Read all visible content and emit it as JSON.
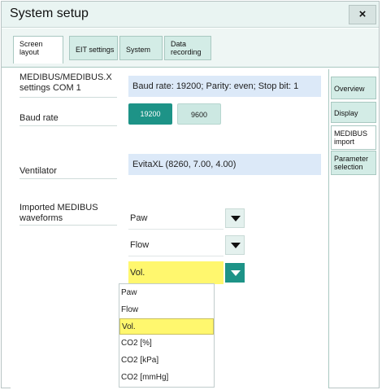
{
  "window": {
    "title": "System setup",
    "close_label": "×"
  },
  "top_tabs": [
    {
      "label": "Screen layout",
      "line1": "Screen",
      "line2": "layout",
      "active": true
    },
    {
      "label": "EIT settings",
      "active": false
    },
    {
      "label": "System",
      "active": false
    },
    {
      "label": "Data recording",
      "line1": "Data",
      "line2": "recording",
      "active": false
    }
  ],
  "side_tabs": [
    {
      "label": "Overview",
      "active": false
    },
    {
      "label": "Display",
      "active": false
    },
    {
      "label": "MEDIBUS import",
      "line1": "MEDIBUS",
      "line2": "import",
      "active": true
    },
    {
      "label": "Parameter selection",
      "line1": "Parameter",
      "line2": "selection",
      "active": false
    }
  ],
  "settings": {
    "com_label": "MEDIBUS/MEDIBUS.X settings COM 1",
    "com_label_line1": "MEDIBUS/MEDIBUS.X",
    "com_label_line2": "settings COM 1",
    "com_value": "Baud rate: 19200; Parity: even; Stop bit: 1",
    "baud_label": "Baud rate",
    "baud_options": [
      "19200",
      "9600"
    ],
    "baud_selected": "19200",
    "ventilator_label": "Ventilator",
    "ventilator_value": "EvitaXL (8260, 7.00, 4.00)",
    "waveforms_label": "Imported MEDIBUS waveforms",
    "waveforms_label_line1": "Imported MEDIBUS",
    "waveforms_label_line2": "waveforms",
    "waveform_selects": [
      "Paw",
      "Flow",
      "Vol."
    ],
    "open_dropdown_options": [
      "Paw",
      "Flow",
      "Vol.",
      "CO2 [%]",
      "CO2 [kPa]",
      "CO2 [mmHg]"
    ],
    "open_dropdown_selected": "Vol."
  },
  "colors": {
    "accent": "#1d9387",
    "highlight": "#fff76e",
    "value_box": "#dce9f8",
    "tab": "#d3ece6"
  }
}
